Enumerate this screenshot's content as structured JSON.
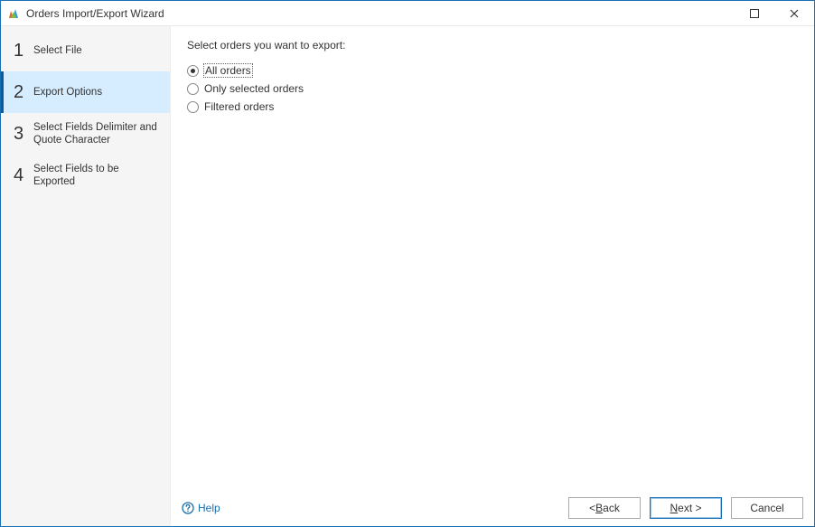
{
  "title": "Orders Import/Export Wizard",
  "steps": [
    {
      "num": "1",
      "label": "Select File"
    },
    {
      "num": "2",
      "label": "Export Options"
    },
    {
      "num": "3",
      "label": "Select Fields Delimiter and Quote Character"
    },
    {
      "num": "4",
      "label": "Select Fields to be Exported"
    }
  ],
  "activeStepIndex": 1,
  "content": {
    "prompt": "Select orders you want to export:",
    "options": [
      {
        "label": "All orders",
        "selected": true,
        "focused": true
      },
      {
        "label": "Only selected orders",
        "selected": false,
        "focused": false
      },
      {
        "label": "Filtered orders",
        "selected": false,
        "focused": false
      }
    ]
  },
  "footer": {
    "help": "Help",
    "back_prefix": "< ",
    "back_accel": "B",
    "back_rest": "ack",
    "next_accel": "N",
    "next_rest": "ext >",
    "cancel": "Cancel"
  }
}
